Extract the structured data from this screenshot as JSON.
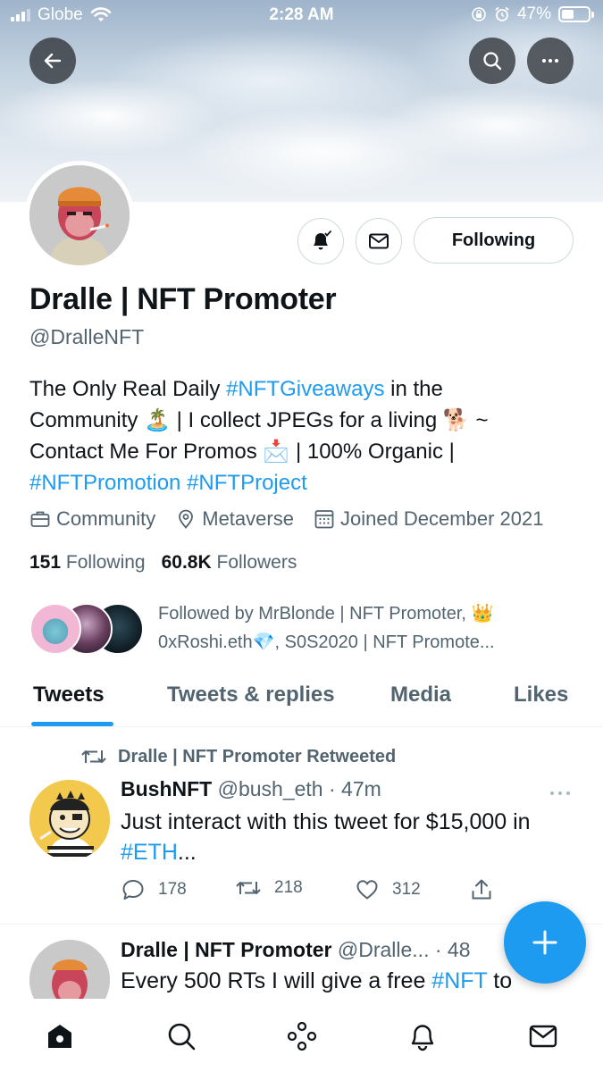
{
  "status_bar": {
    "carrier": "Globe",
    "time": "2:28 AM",
    "battery_percent": "47%",
    "battery_level": 0.47
  },
  "header": {
    "back_icon": "arrow-left-icon",
    "search_icon": "search-icon",
    "more_icon": "more-horizontal-icon"
  },
  "profile": {
    "display_name": "Dralle | NFT Promoter",
    "handle": "@DralleNFT",
    "bio": {
      "line1_pre": "The Only Real Daily ",
      "line1_tag": "#NFTGiveaways",
      "line1_post": " in the",
      "line2": "Community 🏝️ | I collect JPEGs for a living 🐕 ~",
      "line3": "Contact Me For Promos 📩 | 100% Organic |",
      "tag1": "#NFTPromotion",
      "tag2": "#NFTProject"
    },
    "category": "Community",
    "location": "Metaverse",
    "joined": "Joined December 2021",
    "following_count": "151",
    "following_label": "Following",
    "followers_count": "60.8K",
    "followers_label": "Followers",
    "followed_by_line1": "Followed by MrBlonde | NFT Promoter, 👑",
    "followed_by_line2": "0xRoshi.eth💎, S0S2020 | NFT Promote..."
  },
  "actions": {
    "following_button": "Following"
  },
  "tabs": [
    {
      "label": "Tweets",
      "active": true
    },
    {
      "label": "Tweets & replies",
      "active": false
    },
    {
      "label": "Media",
      "active": false
    },
    {
      "label": "Likes",
      "active": false
    }
  ],
  "tweets": [
    {
      "retweeted_by": "Dralle | NFT Promoter Retweeted",
      "author": "BushNFT",
      "handle_time": "@bush_eth · 47m",
      "text_line1": "Just interact with this tweet for $15,000 in",
      "text_tag": "#ETH",
      "text_tail": "...",
      "replies": "178",
      "retweets": "218",
      "likes": "312"
    },
    {
      "author": "Dralle | NFT Promoter",
      "handle_time": "@Dralle... · 48",
      "text_pre": "Every 500 RTs I will give a free ",
      "text_tag": "#NFT",
      "text_post": " to"
    }
  ],
  "colors": {
    "accent": "#1d9bf0",
    "text_primary": "#0f1419",
    "text_secondary": "#536471",
    "border": "#cfd9de"
  }
}
